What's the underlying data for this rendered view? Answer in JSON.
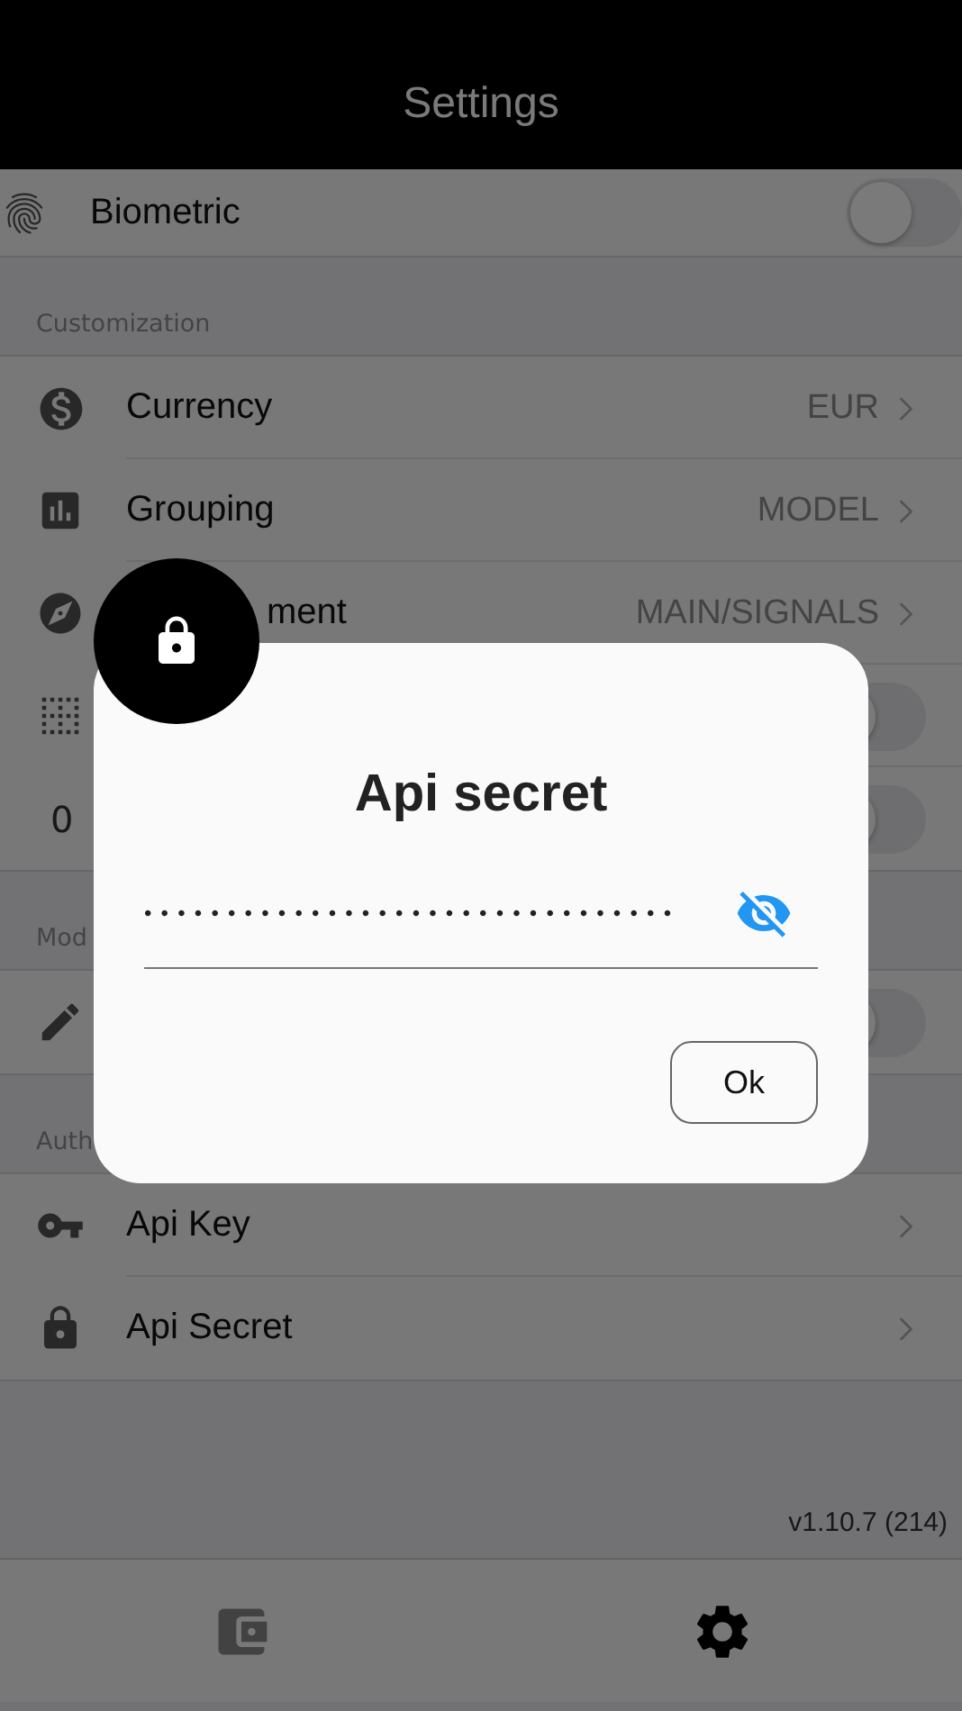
{
  "header": {
    "title": "Settings"
  },
  "sections": [
    {
      "rows": [
        {
          "kind": "toggle",
          "label": "Biometric",
          "on": false
        }
      ]
    },
    {
      "title": "Customization",
      "rows": [
        {
          "kind": "link",
          "label": "Currency",
          "value": "EUR"
        },
        {
          "kind": "link",
          "label": "Grouping",
          "value": "MODEL"
        },
        {
          "kind": "link",
          "label": "ment",
          "value": "MAIN/SIGNALS",
          "partially_hidden": true
        },
        {
          "kind": "toggle",
          "on": false
        },
        {
          "kind": "toggle",
          "leading_text": "0",
          "on": false
        }
      ]
    },
    {
      "title": "Mod",
      "rows": [
        {
          "kind": "toggle",
          "on": false
        }
      ]
    },
    {
      "title": "Auth",
      "rows": [
        {
          "kind": "link",
          "label": "Api Key"
        },
        {
          "kind": "link",
          "label": "Api Secret"
        }
      ]
    }
  ],
  "version": "v1.10.7 (214)",
  "tabs": [
    {
      "selected": false
    },
    {
      "selected": true
    }
  ],
  "dialog": {
    "title": "Api secret",
    "value": "••••••••••••••••••••••••••••••••",
    "password_visible": false,
    "button": "Ok"
  }
}
